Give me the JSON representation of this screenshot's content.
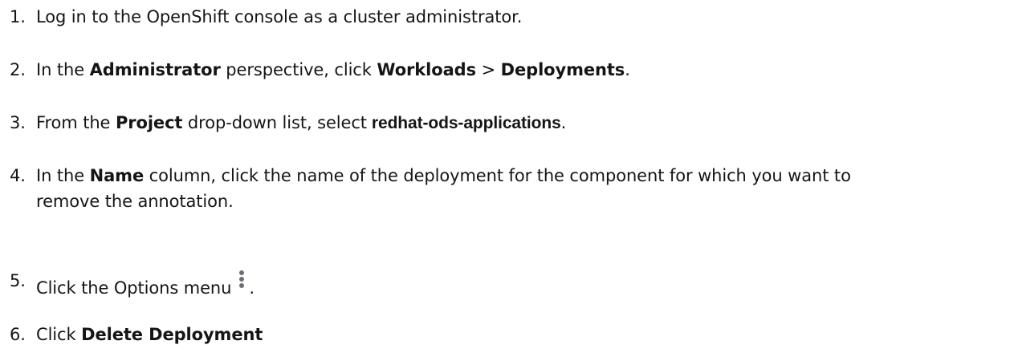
{
  "steps": [
    {
      "num": "1.",
      "parts": {
        "t1": "Log in to the OpenShift console as a cluster administrator."
      }
    },
    {
      "num": "2.",
      "parts": {
        "t1": "In the ",
        "b1": "Administrator",
        "t2": " perspective, click ",
        "b2": "Workloads",
        "t3": " > ",
        "b3": "Deployments",
        "t4": "."
      }
    },
    {
      "num": "3.",
      "parts": {
        "t1": "From the ",
        "b1": "Project",
        "t2": " drop-down list, select",
        "code": "redhat-ods-applications",
        "t3": "."
      }
    },
    {
      "num": "4.",
      "parts": {
        "t1": "In the ",
        "b1": "Name",
        "t2": " column, click the name of the deployment for the component for which you want to",
        "line2": "remove the annotation."
      }
    },
    {
      "num": "5.",
      "parts": {
        "t1": "Click the Options menu",
        "icon": "kebab-menu-icon",
        "t2": "."
      }
    },
    {
      "num": "6.",
      "parts": {
        "t1": "Click ",
        "b1": "Delete Deployment"
      }
    }
  ],
  "colors": {
    "text": "#151515",
    "icon": "#6a6e73"
  }
}
